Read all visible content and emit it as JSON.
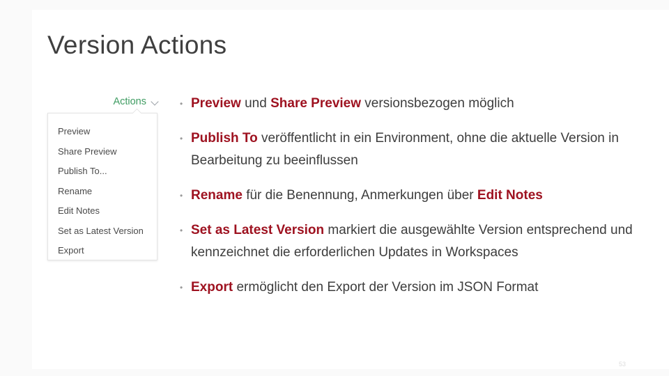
{
  "slide": {
    "title": "Version Actions",
    "page_number": "53"
  },
  "screenshot": {
    "trigger_label": "Actions",
    "chevron_icon": "chevron-down-icon",
    "menu_items": [
      "Preview",
      "Share Preview",
      "Publish To...",
      "Rename",
      "Edit Notes",
      "Set as Latest Version",
      "Export"
    ]
  },
  "bullets": [
    {
      "marker": "•",
      "parts": [
        {
          "text": "Preview",
          "style": "keyword"
        },
        {
          "text": " und ",
          "style": "normal"
        },
        {
          "text": "Share Preview",
          "style": "keyword"
        },
        {
          "text": " versionsbezogen möglich",
          "style": "normal"
        }
      ]
    },
    {
      "marker": "•",
      "parts": [
        {
          "text": "Publish To",
          "style": "keyword"
        },
        {
          "text": " veröffentlicht in ein Environment, ohne die aktuelle Version in Bearbeitung zu beeinflussen",
          "style": "normal"
        }
      ]
    },
    {
      "marker": "•",
      "parts": [
        {
          "text": "Rename",
          "style": "keyword"
        },
        {
          "text": " für die Benennung, Anmerkungen über ",
          "style": "normal"
        },
        {
          "text": "Edit Notes",
          "style": "keyword"
        }
      ]
    },
    {
      "marker": "•",
      "parts": [
        {
          "text": "Set as Latest Version",
          "style": "keyword"
        },
        {
          "text": " markiert die ausgewählte Version entsprechend und kennzeichnet die erforderlichen Updates in Workspaces",
          "style": "normal"
        }
      ]
    },
    {
      "marker": "•",
      "parts": [
        {
          "text": "Export",
          "style": "keyword"
        },
        {
          "text": " ermöglicht den Export der Version im JSON Format",
          "style": "normal"
        }
      ]
    }
  ],
  "colors": {
    "keyword": "#9e1220",
    "body_text": "#3d3d3d",
    "title": "#3f3f3f",
    "actions_green": "#3f9c62"
  }
}
